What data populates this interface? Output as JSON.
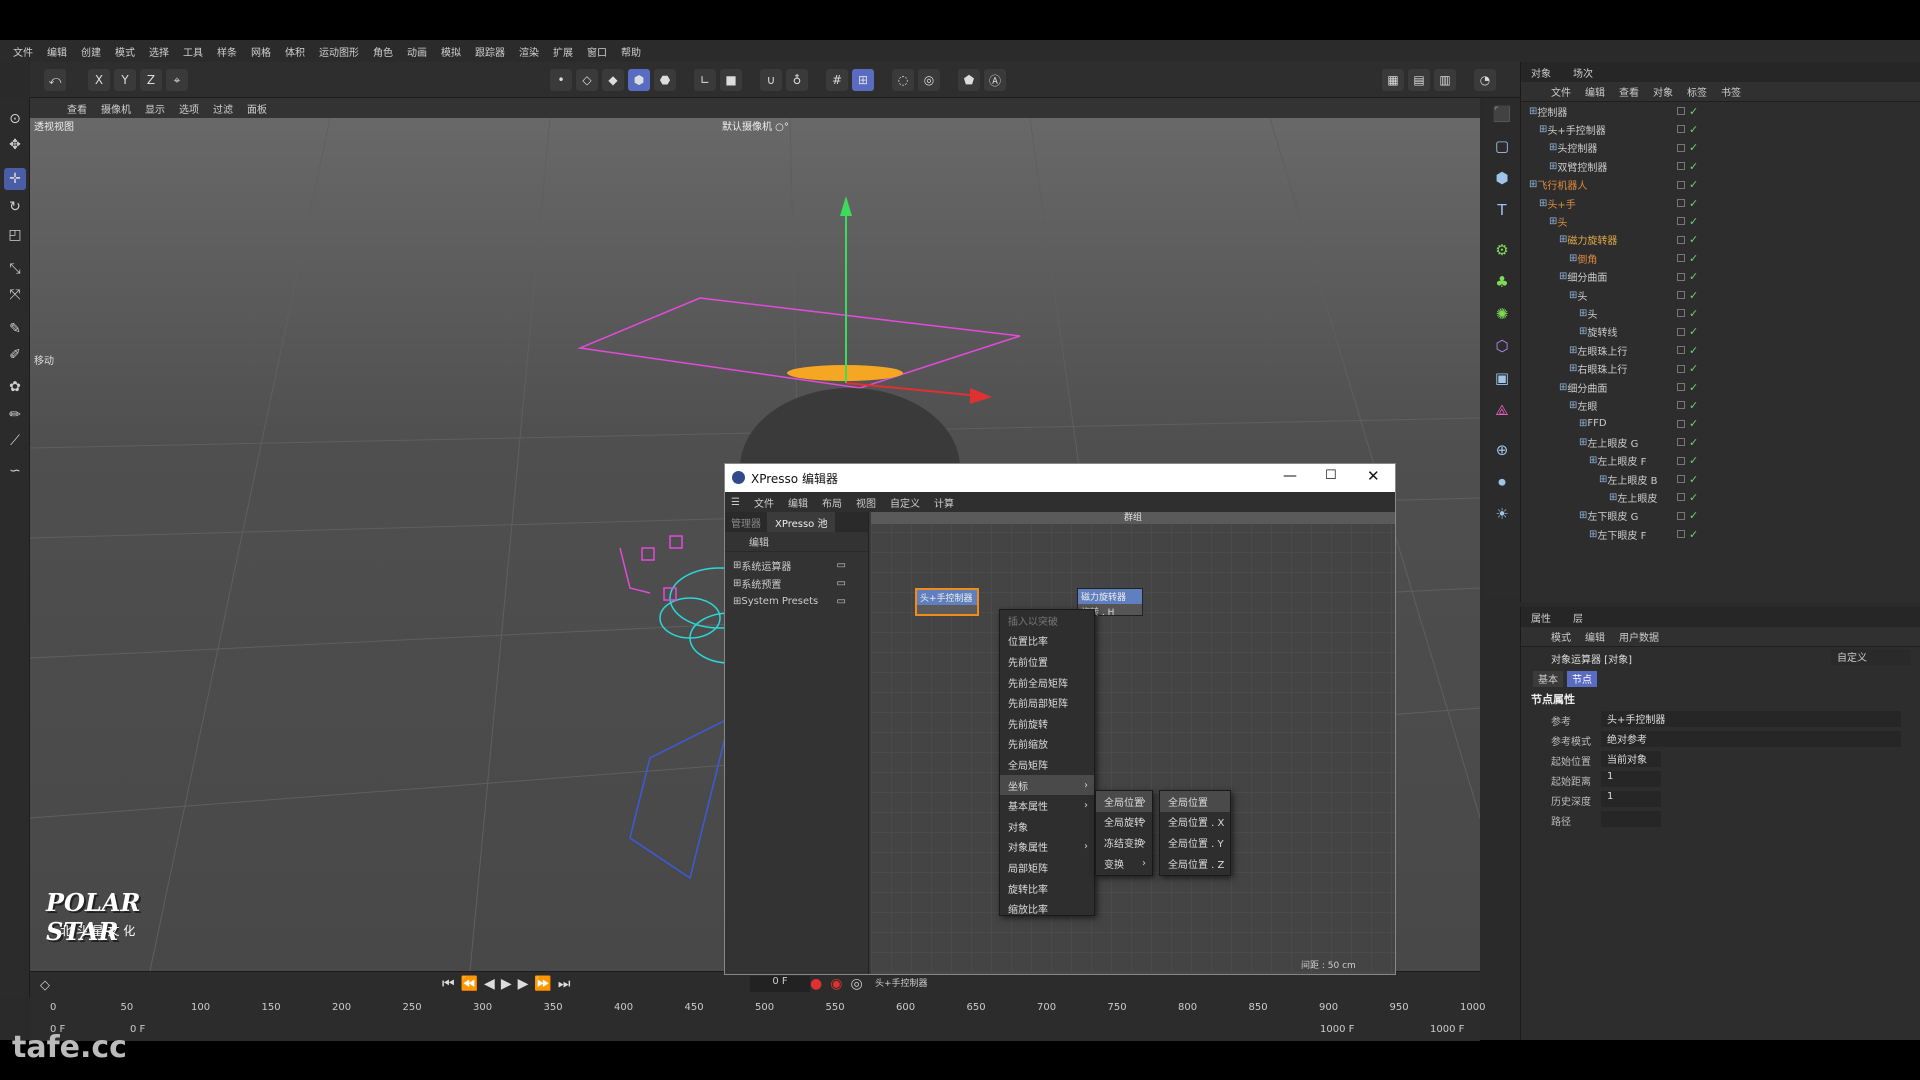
{
  "menubar": [
    "文件",
    "编辑",
    "创建",
    "模式",
    "选择",
    "工具",
    "样条",
    "网格",
    "体积",
    "运动图形",
    "角色",
    "动画",
    "模拟",
    "跟踪器",
    "渲染",
    "扩展",
    "窗口",
    "帮助"
  ],
  "toolbar": {
    "axes": [
      "X",
      "Y",
      "Z"
    ]
  },
  "viewport": {
    "menu": [
      "查看",
      "摄像机",
      "显示",
      "选项",
      "过滤",
      "面板"
    ],
    "label": "透视视图",
    "camera": "默认摄像机 ○°",
    "move_label": "移动",
    "brand": "POLAR STAR",
    "brand_sub": "北 斗 星 文 化"
  },
  "object_manager": {
    "tabs": [
      "对象",
      "场次"
    ],
    "menu": [
      "文件",
      "编辑",
      "查看",
      "对象",
      "标签",
      "书签"
    ],
    "rows": [
      {
        "label": "控制器",
        "depth": 0
      },
      {
        "label": "头+手控制器",
        "depth": 1
      },
      {
        "label": "头控制器",
        "depth": 2
      },
      {
        "label": "双臂控制器",
        "depth": 2
      },
      {
        "label": "飞行机器人",
        "depth": 0,
        "color": "#e08a3c"
      },
      {
        "label": "头+手",
        "depth": 1,
        "color": "#e08a3c"
      },
      {
        "label": "头",
        "depth": 2,
        "color": "#e08a3c"
      },
      {
        "label": "磁力旋转器",
        "depth": 3,
        "color": "#e0a84a"
      },
      {
        "label": "倒角",
        "depth": 4,
        "color": "#e08a3c"
      },
      {
        "label": "细分曲面",
        "depth": 3
      },
      {
        "label": "头",
        "depth": 4
      },
      {
        "label": "头",
        "depth": 5
      },
      {
        "label": "旋转线",
        "depth": 5
      },
      {
        "label": "左眼珠上行",
        "depth": 4
      },
      {
        "label": "右眼珠上行",
        "depth": 4
      },
      {
        "label": "细分曲面",
        "depth": 3
      },
      {
        "label": "左眼",
        "depth": 4
      },
      {
        "label": "FFD",
        "depth": 5
      },
      {
        "label": "左上眼皮 G",
        "depth": 5
      },
      {
        "label": "左上眼皮 F",
        "depth": 6
      },
      {
        "label": "左上眼皮 B",
        "depth": 7
      },
      {
        "label": "左上眼皮",
        "depth": 8
      },
      {
        "label": "左下眼皮 G",
        "depth": 5
      },
      {
        "label": "左下眼皮 F",
        "depth": 6
      }
    ]
  },
  "attributes": {
    "tabs": [
      "属性",
      "层"
    ],
    "menu": [
      "模式",
      "编辑",
      "用户数据"
    ],
    "title": "对象运算器 [对象]",
    "preset": "自定义",
    "subtabs": [
      "基本",
      "节点"
    ],
    "section": "节点属性",
    "fields": [
      {
        "label": "参考",
        "value": "头+手控制器"
      },
      {
        "label": "参考模式",
        "value": "绝对参考"
      },
      {
        "label": "起始位置",
        "value": "当前对象"
      },
      {
        "label": "起始距离",
        "value": "1"
      },
      {
        "label": "历史深度",
        "value": "1"
      },
      {
        "label": "路径",
        "value": ""
      }
    ]
  },
  "xpresso": {
    "title": "XPresso 编辑器",
    "menu": [
      "文件",
      "编辑",
      "布局",
      "视图",
      "自定义",
      "计算"
    ],
    "tabs": [
      "管理器",
      "XPresso 池"
    ],
    "left_menu": "编辑",
    "pool": [
      "系统运算器",
      "系统预置",
      "System Presets"
    ],
    "group": "群组",
    "node1": "头+手控制器",
    "node2": {
      "title": "磁力旋转器",
      "port": "旋转 . H"
    },
    "context_header": "插入以突破",
    "context_items": [
      "位置比率",
      "先前位置",
      "先前全局矩阵",
      "先前局部矩阵",
      "先前旋转",
      "先前缩放",
      "全局矩阵",
      "坐标",
      "基本属性",
      "对象",
      "对象属性",
      "局部矩阵",
      "旋转比率",
      "缩放比率"
    ],
    "submenu1": [
      "全局位置",
      "全局旋转",
      "冻结变换",
      "变换"
    ],
    "submenu2": [
      "全局位置",
      "全局位置 . X",
      "全局位置 . Y",
      "全局位置 . Z"
    ],
    "distance": "间距 : 50 cm",
    "status": "头+手控制器"
  },
  "timeline": {
    "ticks": [
      "0",
      "50",
      "100",
      "150",
      "200",
      "250",
      "300",
      "350",
      "400",
      "450",
      "500",
      "550",
      "600",
      "650",
      "700",
      "750",
      "800",
      "850",
      "900",
      "950",
      "1000"
    ],
    "current": "0 F",
    "start": "0 F",
    "frame": "0 F",
    "end1": "1000 F",
    "end2": "1000 F"
  },
  "watermark": "tafe.cc"
}
